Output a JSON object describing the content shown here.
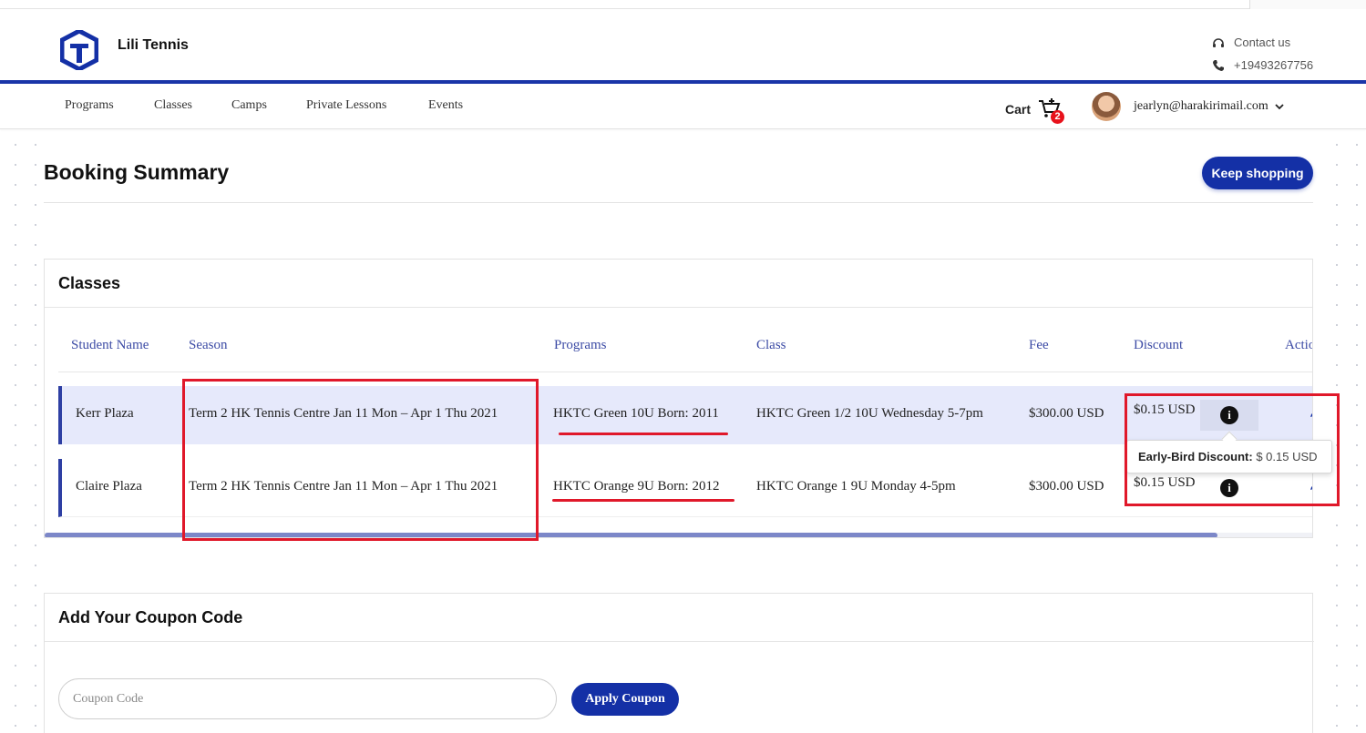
{
  "brand": {
    "name": "Lili Tennis"
  },
  "contact": {
    "label": "Contact us",
    "phone": "+19493267756"
  },
  "nav": {
    "items": [
      "Programs",
      "Classes",
      "Camps",
      "Private Lessons",
      "Events"
    ],
    "cart_label": "Cart",
    "cart_count": "2",
    "user_email": "jearlyn@harakirimail.com"
  },
  "page": {
    "title": "Booking Summary",
    "keep_shopping": "Keep shopping"
  },
  "classes": {
    "title": "Classes",
    "columns": [
      "Student Name",
      "Season",
      "Programs",
      "Class",
      "Fee",
      "Discount",
      "Actio"
    ],
    "rows": [
      {
        "student": "Kerr Plaza",
        "season": "Term 2 HK Tennis Centre Jan 11 Mon – Apr 1 Thu 2021",
        "program": "HKTC Green 10U Born: 2011",
        "class": "HKTC Green 1/2 10U Wednesday 5-7pm",
        "fee": "$300.00 USD",
        "discount": "$0.15 USD"
      },
      {
        "student": "Claire Plaza",
        "season": "Term 2 HK Tennis Centre Jan 11 Mon – Apr 1 Thu 2021",
        "program": "HKTC Orange 9U Born: 2012",
        "class": "HKTC Orange 1 9U Monday 4-5pm",
        "fee": "$300.00 USD",
        "discount": "$0.15 USD"
      }
    ],
    "tooltip": {
      "label": "Early-Bird Discount:",
      "value": "$ 0.15 USD"
    },
    "info_glyph": "i"
  },
  "coupon": {
    "title": "Add Your Coupon Code",
    "placeholder": "Coupon Code",
    "apply_label": "Apply Coupon"
  },
  "colors": {
    "primary": "#1430a6",
    "header_link": "#3c4ba5",
    "row_highlight": "#e6e9fb",
    "annotation_red": "#e0182a",
    "badge_red": "#e8121c"
  },
  "icons": [
    "logo-icon",
    "headset-icon",
    "phone-icon",
    "cart-icon",
    "chevron-down-icon",
    "info-icon",
    "edit-icon"
  ]
}
